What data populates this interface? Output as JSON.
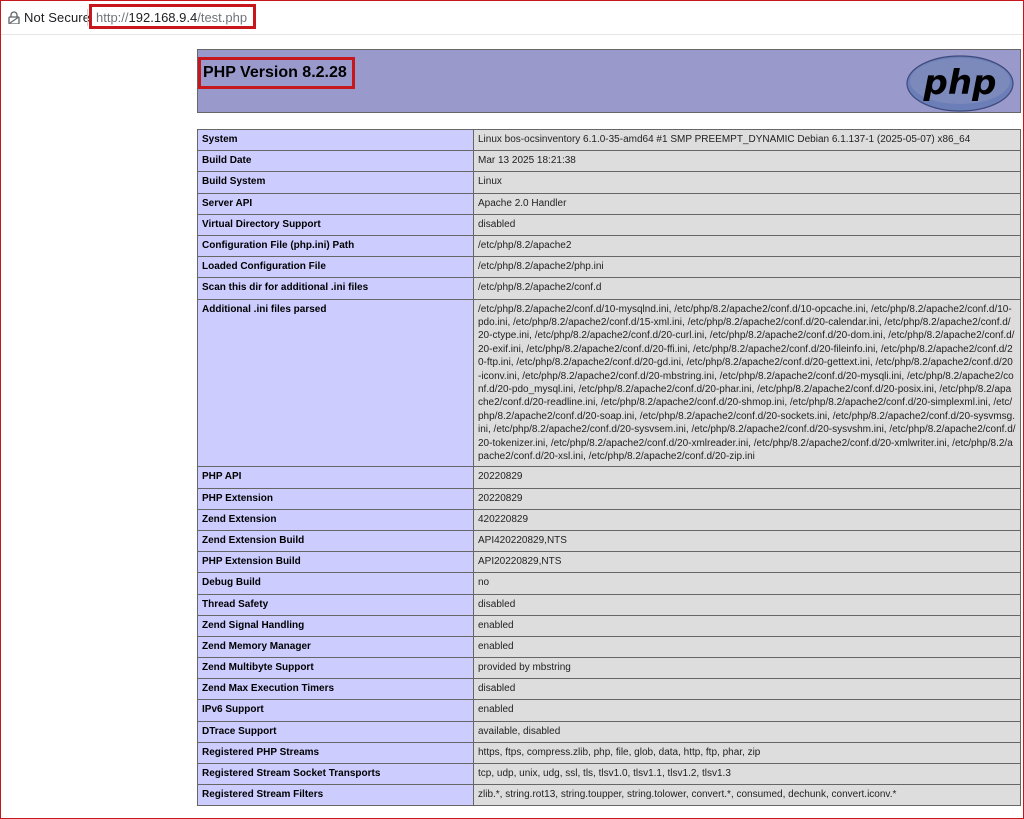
{
  "browser": {
    "security_label": "Not Secure",
    "url_scheme": "http://",
    "url_host": "192.168.9.4",
    "url_path": "/test.php"
  },
  "header": {
    "version": "PHP Version 8.2.28",
    "logo_text": "php"
  },
  "colors": {
    "header_bg": "#9999cc",
    "label_bg": "#ccccff",
    "value_bg": "#dddddd",
    "highlight": "#c8161d"
  },
  "rows": [
    {
      "label": "System",
      "value": "Linux bos-ocsinventory 6.1.0-35-amd64 #1 SMP PREEMPT_DYNAMIC Debian 6.1.137-1 (2025-05-07) x86_64"
    },
    {
      "label": "Build Date",
      "value": "Mar 13 2025 18:21:38"
    },
    {
      "label": "Build System",
      "value": "Linux"
    },
    {
      "label": "Server API",
      "value": "Apache 2.0 Handler"
    },
    {
      "label": "Virtual Directory Support",
      "value": "disabled"
    },
    {
      "label": "Configuration File (php.ini) Path",
      "value": "/etc/php/8.2/apache2"
    },
    {
      "label": "Loaded Configuration File",
      "value": "/etc/php/8.2/apache2/php.ini"
    },
    {
      "label": "Scan this dir for additional .ini files",
      "value": "/etc/php/8.2/apache2/conf.d"
    },
    {
      "label": "Additional .ini files parsed",
      "value": "/etc/php/8.2/apache2/conf.d/10-mysqlnd.ini, /etc/php/8.2/apache2/conf.d/10-opcache.ini, /etc/php/8.2/apache2/conf.d/10-pdo.ini, /etc/php/8.2/apache2/conf.d/15-xml.ini, /etc/php/8.2/apache2/conf.d/20-calendar.ini, /etc/php/8.2/apache2/conf.d/20-ctype.ini, /etc/php/8.2/apache2/conf.d/20-curl.ini, /etc/php/8.2/apache2/conf.d/20-dom.ini, /etc/php/8.2/apache2/conf.d/20-exif.ini, /etc/php/8.2/apache2/conf.d/20-ffi.ini, /etc/php/8.2/apache2/conf.d/20-fileinfo.ini, /etc/php/8.2/apache2/conf.d/20-ftp.ini, /etc/php/8.2/apache2/conf.d/20-gd.ini, /etc/php/8.2/apache2/conf.d/20-gettext.ini, /etc/php/8.2/apache2/conf.d/20-iconv.ini, /etc/php/8.2/apache2/conf.d/20-mbstring.ini, /etc/php/8.2/apache2/conf.d/20-mysqli.ini, /etc/php/8.2/apache2/conf.d/20-pdo_mysql.ini, /etc/php/8.2/apache2/conf.d/20-phar.ini, /etc/php/8.2/apache2/conf.d/20-posix.ini, /etc/php/8.2/apache2/conf.d/20-readline.ini, /etc/php/8.2/apache2/conf.d/20-shmop.ini, /etc/php/8.2/apache2/conf.d/20-simplexml.ini, /etc/php/8.2/apache2/conf.d/20-soap.ini, /etc/php/8.2/apache2/conf.d/20-sockets.ini, /etc/php/8.2/apache2/conf.d/20-sysvmsg.ini, /etc/php/8.2/apache2/conf.d/20-sysvsem.ini, /etc/php/8.2/apache2/conf.d/20-sysvshm.ini, /etc/php/8.2/apache2/conf.d/20-tokenizer.ini, /etc/php/8.2/apache2/conf.d/20-xmlreader.ini, /etc/php/8.2/apache2/conf.d/20-xmlwriter.ini, /etc/php/8.2/apache2/conf.d/20-xsl.ini, /etc/php/8.2/apache2/conf.d/20-zip.ini"
    },
    {
      "label": "PHP API",
      "value": "20220829"
    },
    {
      "label": "PHP Extension",
      "value": "20220829"
    },
    {
      "label": "Zend Extension",
      "value": "420220829"
    },
    {
      "label": "Zend Extension Build",
      "value": "API420220829,NTS"
    },
    {
      "label": "PHP Extension Build",
      "value": "API20220829,NTS"
    },
    {
      "label": "Debug Build",
      "value": "no"
    },
    {
      "label": "Thread Safety",
      "value": "disabled"
    },
    {
      "label": "Zend Signal Handling",
      "value": "enabled"
    },
    {
      "label": "Zend Memory Manager",
      "value": "enabled"
    },
    {
      "label": "Zend Multibyte Support",
      "value": "provided by mbstring"
    },
    {
      "label": "Zend Max Execution Timers",
      "value": "disabled"
    },
    {
      "label": "IPv6 Support",
      "value": "enabled"
    },
    {
      "label": "DTrace Support",
      "value": "available, disabled"
    },
    {
      "label": "Registered PHP Streams",
      "value": "https, ftps, compress.zlib, php, file, glob, data, http, ftp, phar, zip"
    },
    {
      "label": "Registered Stream Socket Transports",
      "value": "tcp, udp, unix, udg, ssl, tls, tlsv1.0, tlsv1.1, tlsv1.2, tlsv1.3"
    },
    {
      "label": "Registered Stream Filters",
      "value": "zlib.*, string.rot13, string.toupper, string.tolower, convert.*, consumed, dechunk, convert.iconv.*"
    }
  ]
}
